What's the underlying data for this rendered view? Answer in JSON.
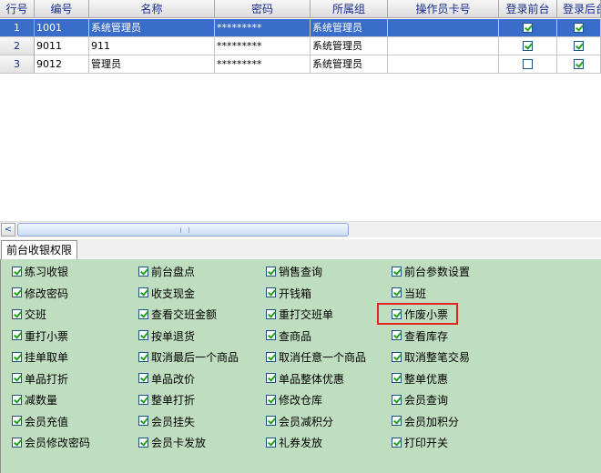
{
  "grid": {
    "columns": [
      "行号",
      "编号",
      "名称",
      "密码",
      "所属组",
      "操作员卡号",
      "登录前台",
      "登录后台"
    ],
    "rows": [
      {
        "row_no": "1",
        "code": "1001",
        "name": "系统管理员",
        "password": "*********",
        "group": "系统管理员",
        "card": "",
        "front": true,
        "back": true,
        "selected": true
      },
      {
        "row_no": "2",
        "code": "9011",
        "name": "911",
        "password": "*********",
        "group": "系统管理员",
        "card": "",
        "front": true,
        "back": true,
        "selected": false
      },
      {
        "row_no": "3",
        "code": "9012",
        "name": "管理员",
        "password": "*********",
        "group": "系统管理员",
        "card": "",
        "front": false,
        "back": true,
        "selected": false
      }
    ]
  },
  "scrollbar": {
    "left_arrow": "<",
    "right_arrow": ">"
  },
  "tab": {
    "label": "前台收银权限"
  },
  "permissions": [
    [
      "练习收银",
      "前台盘点",
      "销售查询",
      "前台参数设置"
    ],
    [
      "修改密码",
      "收支现金",
      "开钱箱",
      "当班"
    ],
    [
      "交班",
      "查看交班金额",
      "重打交班单",
      "作废小票"
    ],
    [
      "重打小票",
      "按单退货",
      "查商品",
      "查看库存"
    ],
    [
      "挂单取单",
      "取消最后一个商品",
      "取消任意一个商品",
      "取消整笔交易"
    ],
    [
      "单品打折",
      "单品改价",
      "单品整体优惠",
      "整单优惠"
    ],
    [
      "减数量",
      "整单打折",
      "修改仓库",
      "会员查询"
    ],
    [
      "会员充值",
      "会员挂失",
      "会员减积分",
      "会员加积分"
    ],
    [
      "会员修改密码",
      "会员卡发放",
      "礼券发放",
      "打印开关"
    ]
  ],
  "colors": {
    "selection": "#3a6cc9",
    "panel_bg": "#bfddbf",
    "highlight": "#e0271f",
    "check": "#21a121"
  }
}
